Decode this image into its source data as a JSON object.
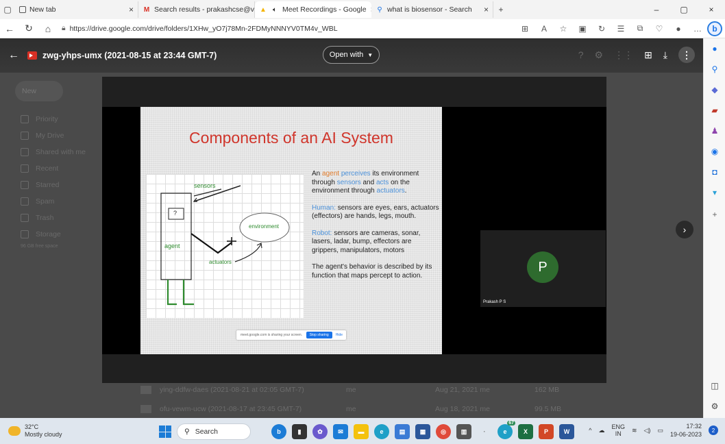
{
  "browser": {
    "tabs": [
      {
        "label": "New tab",
        "icon": "page-icon",
        "active": false
      },
      {
        "label": "Search results - prakashcse@vce",
        "icon": "gmail-icon",
        "active": false
      },
      {
        "label": "Meet Recordings - Google",
        "icon": "drive-icon",
        "active": true
      },
      {
        "label": "what is biosensor - Search",
        "icon": "search-icon",
        "active": false
      }
    ],
    "new_tab_symbol": "+",
    "url": "https://drive.google.com/drive/folders/1XHw_yO7j78Mn-2FDMyNNNYV0TM4v_WBL"
  },
  "viewer": {
    "file_title": "zwg-yhps-umx (2021-08-15 at 23:44 GMT-7)",
    "open_with_label": "Open with"
  },
  "drive_background": {
    "new_label": "New",
    "sidebar": [
      "Priority",
      "My Drive",
      "Shared with me",
      "Recent",
      "Starred",
      "Spam",
      "Trash",
      "Storage"
    ],
    "storage_text": "96 GB free space",
    "rows": [
      {
        "name": "ying-ddfw-daes (2021-08-21 at 02:05 GMT-7)",
        "owner": "me",
        "date": "Aug 21, 2021 me",
        "size": "162 MB"
      },
      {
        "name": "ofu-vewm-ucw (2021-08-17 at 23:45 GMT-7)",
        "owner": "me",
        "date": "Aug 18, 2021 me",
        "size": "99.5 MB"
      }
    ]
  },
  "slide": {
    "title": "Components of an AI System",
    "diagram": {
      "sensors_label": "sensors",
      "question_label": "?",
      "environment_label": "environment",
      "agent_label": "agent",
      "actuators_label": "actuators"
    },
    "para1": {
      "a": "An ",
      "agent": "agent",
      "b": " ",
      "perceives": "perceives",
      "c": " its environment through ",
      "sensors": "sensors",
      "d": " and ",
      "acts": "acts",
      "e": " on the environment through ",
      "actuators": "actuators",
      "f": "."
    },
    "para2": {
      "label": "Human:",
      "text": " sensors are eyes, ears, actuators (effectors) are hands, legs, mouth."
    },
    "para3": {
      "label": "Robot:",
      "text": " sensors are cameras, sonar, lasers, ladar, bump, effectors are grippers, manipulators, motors"
    },
    "para4": "The agent's behavior is described by its function that maps percept to action.",
    "share_bar": {
      "text": "meet.google.com is sharing your screen.",
      "stop": "Stop sharing",
      "hide": "Hide"
    }
  },
  "participant": {
    "initial": "P",
    "name": "Prakash P S"
  },
  "taskbar": {
    "temp": "32°C",
    "weather": "Mostly cloudy",
    "search_placeholder": "Search",
    "lang_top": "ENG",
    "lang_bottom": "IN",
    "time": "17:32",
    "date": "19-06-2023",
    "badge_count": "67",
    "notif_count": "2"
  },
  "colors": {
    "slide_title": "#d0352b",
    "term_blue": "#4a90d9",
    "term_orange": "#e07b2a",
    "avatar_green": "#2e6b2e"
  }
}
